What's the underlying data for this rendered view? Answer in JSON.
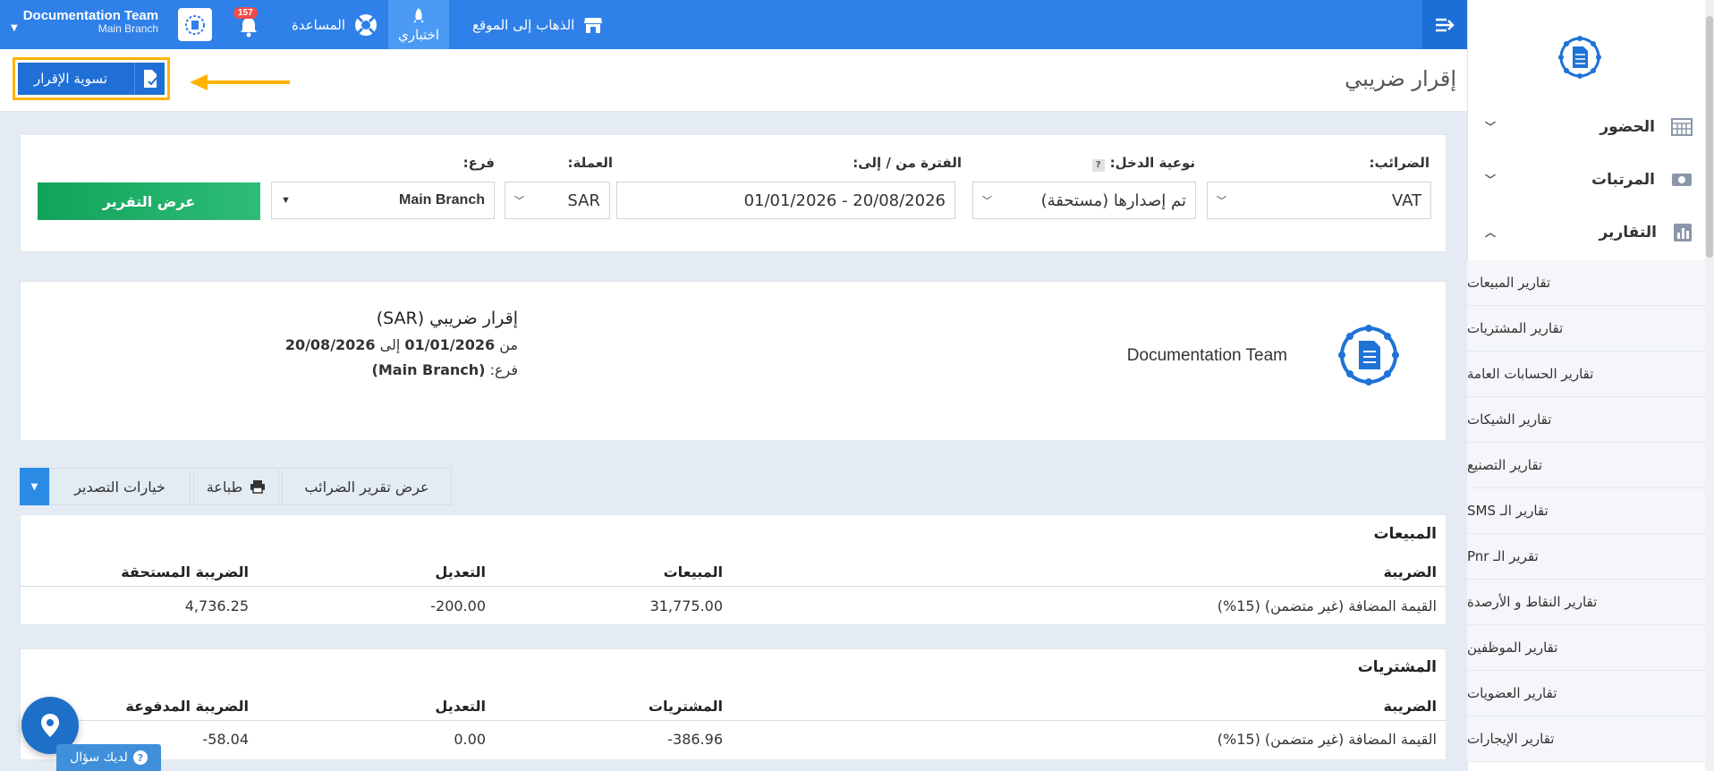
{
  "topbar": {
    "company": "Documentation Team",
    "branch": "Main Branch",
    "notifications_count": "157",
    "help_label": "المساعدة",
    "trial_label": "اختباري",
    "visit_site_label": "الذهاب إلى الموقع"
  },
  "page": {
    "title": "إقرار ضريبي",
    "settle_button": "تسوية الإقرار"
  },
  "filters": {
    "taxes_label": "الضرائب:",
    "taxes_value": "VAT",
    "income_type_label": "نوعية الدخل:",
    "income_type_help": "?",
    "income_type_value": "تم إصدارها (مستحقة)",
    "period_label": "الفترة من / إلى:",
    "period_value": "01/01/2026 - 20/08/2026",
    "currency_label": "العملة:",
    "currency_value": "SAR",
    "branch_label": "فرع:",
    "branch_value": "Main Branch",
    "show_report_button": "عرض التقرير"
  },
  "report_header": {
    "company": "Documentation Team",
    "title": "إقرار ضريبي (SAR)",
    "from_label": "من",
    "from_date": "01/01/2026",
    "to_label": "إلى",
    "to_date": "20/08/2026",
    "branch_label": "فرع:",
    "branch_value": "(Main Branch)"
  },
  "actions": {
    "export_options": "خيارات التصدير",
    "print": "طباعة",
    "show_tax_report": "عرض تقرير الضرائب"
  },
  "sales_table": {
    "section_title": "المبيعات",
    "headers": [
      "الضريبة",
      "المبيعات",
      "التعديل",
      "الضريبة المستحقة"
    ],
    "rows": [
      [
        "القيمة المضافة (غير متضمن) (15%)",
        "31,775.00",
        "-200.00",
        "4,736.25"
      ]
    ]
  },
  "purchases_table": {
    "section_title": "المشتريات",
    "headers": [
      "الضريبة",
      "المشتريات",
      "التعديل",
      "الضريبة المدفوعة"
    ],
    "rows": [
      [
        "القيمة المضافة (غير متضمن) (15%)",
        "-386.96",
        "0.00",
        "-58.04"
      ]
    ]
  },
  "sidebar": {
    "items": [
      {
        "label": "الحضور",
        "icon": "calendar-grid-icon"
      },
      {
        "label": "المرتبات",
        "icon": "money-icon"
      },
      {
        "label": "التقارير",
        "icon": "bar-chart-icon"
      }
    ],
    "report_items": [
      "تقارير المبيعات",
      "تقارير المشتريات",
      "تقارير الحسابات العامة",
      "تقارير الشيكات",
      "تقارير التصنيع",
      "تقارير الـ SMS",
      "تقرير الـ Pnr",
      "تقارير النقاط و الأرصدة",
      "تقارير الموظفين",
      "تقارير العضويات",
      "تقارير الإيجارات"
    ]
  },
  "floating": {
    "ask_label": "لديك سؤال"
  },
  "colors": {
    "topbar": "#2f80e8",
    "accent_green": "#12a35a",
    "highlight": "#ffb300",
    "page_bg": "#e4ebf3"
  }
}
